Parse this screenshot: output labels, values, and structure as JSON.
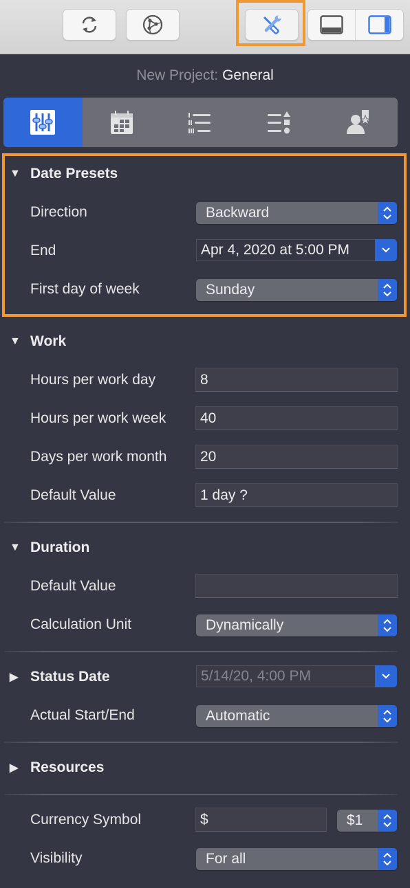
{
  "toolbar": {
    "buttons": [
      {
        "name": "refresh",
        "icon": "refresh-icon"
      },
      {
        "name": "network",
        "icon": "network-icon"
      },
      {
        "name": "inspector",
        "icon": "tools-icon",
        "active": true
      },
      {
        "name": "bottom-pane",
        "icon": "bottom-pane-icon"
      },
      {
        "name": "side-pane",
        "icon": "side-pane-icon",
        "active": true
      }
    ]
  },
  "header": {
    "project_label": "New Project:",
    "section_title": "General"
  },
  "tabs": [
    {
      "name": "general",
      "icon": "sliders-icon",
      "active": true
    },
    {
      "name": "calendar",
      "icon": "calendar-icon"
    },
    {
      "name": "outline",
      "icon": "numbered-list-icon"
    },
    {
      "name": "styles",
      "icon": "shapes-list-icon"
    },
    {
      "name": "resources",
      "icon": "person-star-icon"
    }
  ],
  "date_presets": {
    "title": "Date Presets",
    "expanded": true,
    "direction": {
      "label": "Direction",
      "value": "Backward"
    },
    "end": {
      "label": "End",
      "value": "Apr 4, 2020 at 5:00 PM"
    },
    "first_day": {
      "label": "First day of week",
      "value": "Sunday"
    }
  },
  "work": {
    "title": "Work",
    "expanded": true,
    "hours_day": {
      "label": "Hours per work day",
      "value": "8"
    },
    "hours_week": {
      "label": "Hours per work week",
      "value": "40"
    },
    "days_month": {
      "label": "Days per work month",
      "value": "20"
    },
    "default_value": {
      "label": "Default Value",
      "value": "1 day ?"
    }
  },
  "duration": {
    "title": "Duration",
    "expanded": true,
    "default_value": {
      "label": "Default Value",
      "value": ""
    },
    "calc_unit": {
      "label": "Calculation Unit",
      "value": "Dynamically"
    }
  },
  "status_date": {
    "title": "Status Date",
    "expanded": false,
    "value": "5/14/20, 4:00 PM",
    "actual": {
      "label": "Actual Start/End",
      "value": "Automatic"
    }
  },
  "resources": {
    "title": "Resources",
    "expanded": false
  },
  "currency": {
    "label": "Currency Symbol",
    "value": "$",
    "format": "$1"
  },
  "visibility": {
    "label": "Visibility",
    "value": "For all"
  },
  "colors": {
    "accent": "#2f68d8",
    "highlight": "#ef9834",
    "panel_bg": "#353643"
  }
}
